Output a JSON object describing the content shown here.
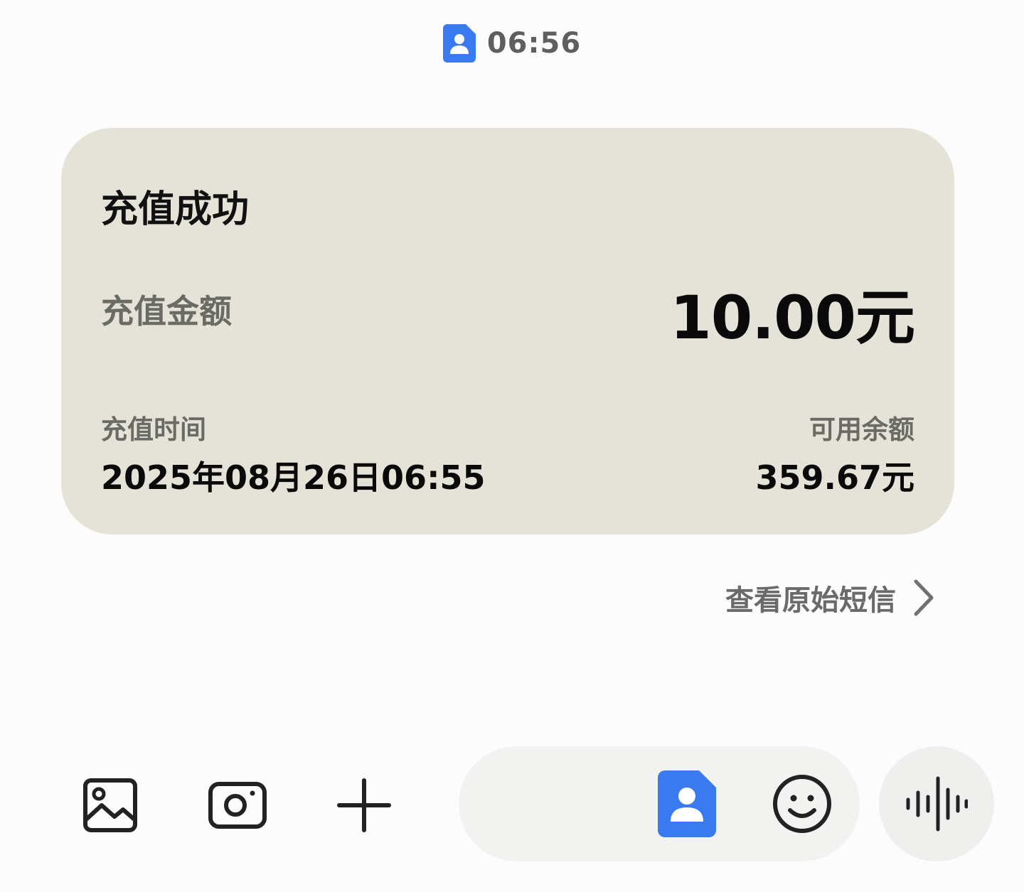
{
  "header": {
    "sim_icon": "sim-card-contact-icon",
    "time": "06:56"
  },
  "card": {
    "title": "充值成功",
    "amount_label": "充值金额",
    "amount_value": "10.00元",
    "time_label": "充值时间",
    "time_value": "2025年08月26日06:55",
    "balance_label": "可用余额",
    "balance_value": "359.67元"
  },
  "view_original": {
    "label": "查看原始短信",
    "icon": "chevron-right-icon"
  },
  "toolbar": {
    "gallery_icon": "image-icon",
    "camera_icon": "camera-icon",
    "add_icon": "plus-icon",
    "sim_icon": "sim-card-contact-icon",
    "emoji_icon": "smiley-icon",
    "voice_icon": "voice-waveform-icon"
  },
  "colors": {
    "card_background": "#e5e3d7",
    "accent_blue": "#3a7af0",
    "page_background": "#fcfcfc"
  }
}
